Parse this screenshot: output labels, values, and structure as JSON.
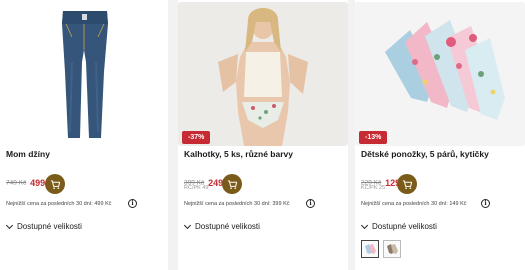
{
  "products": [
    {
      "title": "Mom džíny",
      "old_price": "749 Kč",
      "price": "499 Kč",
      "rrp": "",
      "lowest_price": "Nejnižší cena za posledních 30 dní: 499 Kč",
      "sizes_label": "Dostupné velikosti",
      "cart_icon": "shopping-cart-icon",
      "info_icon": "info-icon"
    },
    {
      "title": "Kalhotky, 5 ks, různé barvy",
      "discount": "-37%",
      "old_price": "399 Kč",
      "price": "249 Kč",
      "rrp": "RČ/PK 49",
      "lowest_price": "Nejnižší cena za posledních 30 dní: 399 Kč",
      "sizes_label": "Dostupné velikosti",
      "cart_icon": "shopping-cart-icon",
      "info_icon": "info-icon"
    },
    {
      "title": "Dětské ponožky, 5 párů, kytičky",
      "discount": "-13%",
      "old_price": "229 Kč",
      "price": "129 Kč",
      "rrp": "KČ/PK 25",
      "lowest_price": "Nejnižší cena za posledních 30 dní: 149 Kč",
      "sizes_label": "Dostupné velikosti",
      "cart_icon": "shopping-cart-icon",
      "info_icon": "info-icon",
      "swatches": [
        "socks-variant-1",
        "socks-variant-2"
      ]
    }
  ],
  "colors": {
    "accent_red": "#c62a33",
    "cart_brown": "#7a5b1a"
  }
}
